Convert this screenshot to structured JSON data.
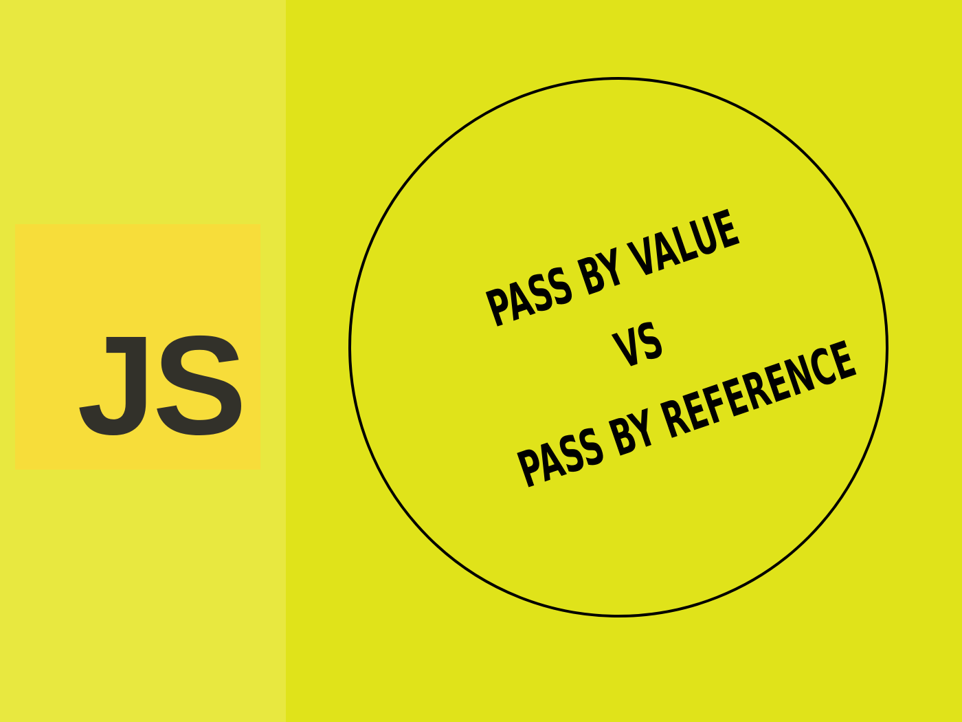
{
  "colors": {
    "left_background": "#e8e840",
    "right_background": "#e0e31a",
    "logo_background": "#f7dd3a",
    "logo_text": "#32312a",
    "circle_stroke": "#000000"
  },
  "logo": {
    "text": "JS"
  },
  "headline": {
    "line1": "PASS BY VALUE",
    "line2": "VS",
    "line3": "PASS BY REFERENCE"
  }
}
